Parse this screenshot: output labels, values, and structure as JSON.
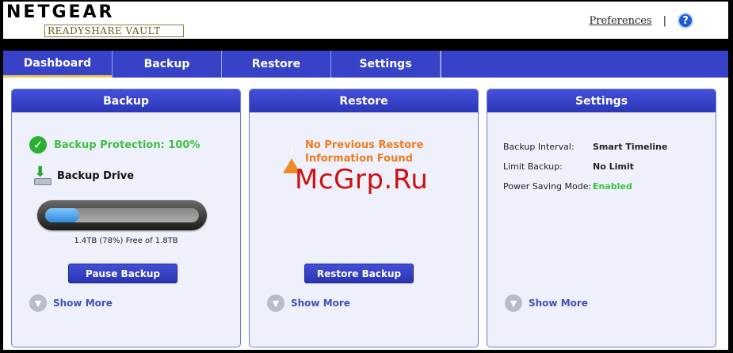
{
  "header": {
    "logo_main": "NETGEAR",
    "logo_sub": "READYSHARE VAULT",
    "preferences": "Preferences",
    "separator": "|",
    "help": "?"
  },
  "nav": {
    "tabs": [
      {
        "label": "Dashboard",
        "active": true
      },
      {
        "label": "Backup"
      },
      {
        "label": "Restore"
      },
      {
        "label": "Settings"
      }
    ]
  },
  "backup_panel": {
    "title": "Backup",
    "protection": "Backup Protection: 100%",
    "drive": "Backup Drive",
    "used_fraction": 0.22,
    "free_text": "1.4TB (78%) Free of 1.8TB",
    "pause_button": "Pause Backup",
    "show_more": "Show More"
  },
  "restore_panel": {
    "title": "Restore",
    "warning": "No Previous Restore Information Found",
    "restore_button": "Restore Backup",
    "show_more": "Show More"
  },
  "settings_panel": {
    "title": "Settings",
    "rows": [
      {
        "label": "Backup Interval:",
        "value": "Smart Timeline"
      },
      {
        "label": "Limit Backup:",
        "value": "No Limit"
      },
      {
        "label": "Power Saving Mode:",
        "value": "Enabled"
      }
    ],
    "show_more": "Show More"
  },
  "watermark": "McGrp.Ru",
  "colors": {
    "nav_blue": "#3742c9",
    "success_green": "#3fbf3f",
    "warning_orange": "#f07a1c",
    "link_blue": "#3e53b8"
  }
}
